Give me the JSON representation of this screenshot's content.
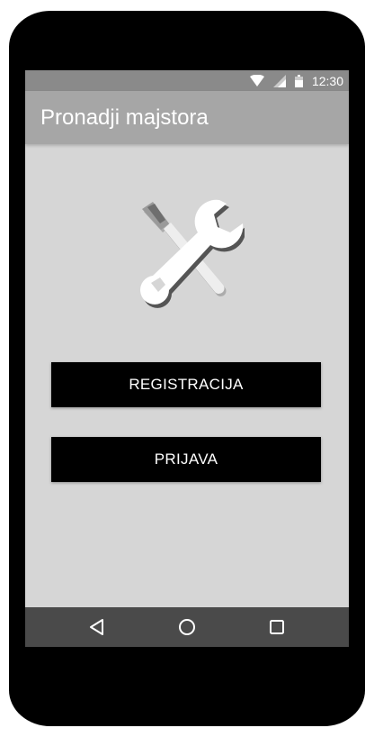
{
  "status_bar": {
    "time": "12:30",
    "icons": [
      "wifi-icon",
      "signal-icon",
      "battery-icon"
    ]
  },
  "app_bar": {
    "title": "Pronadji majstora"
  },
  "logo": {
    "icon": "tools-icon"
  },
  "buttons": {
    "register_label": "REGISTRACIJA",
    "login_label": "PRIJAVA"
  },
  "nav_bar": {
    "icons": [
      "back-icon",
      "home-icon",
      "recent-apps-icon"
    ]
  },
  "colors": {
    "status_bar": "#8a8a8a",
    "app_bar": "#a6a6a6",
    "screen_background": "#d6d6d6",
    "button": "#000000",
    "nav_bar": "#4a4a4a"
  }
}
